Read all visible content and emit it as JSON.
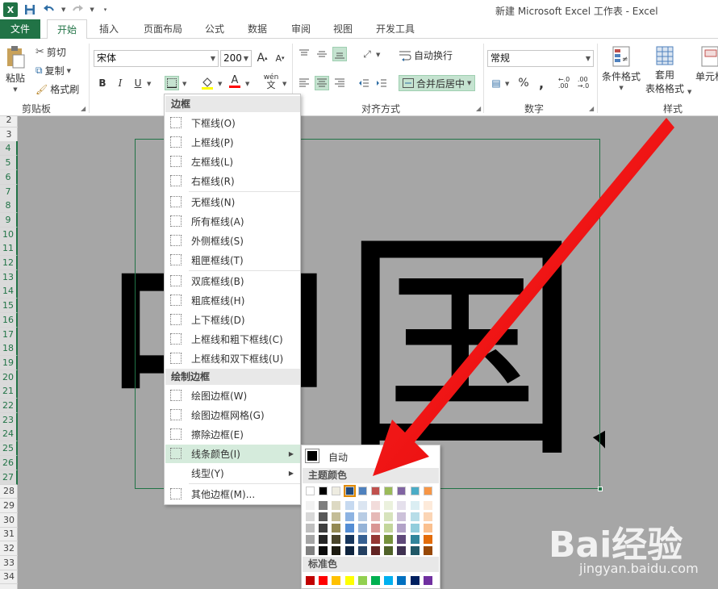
{
  "window": {
    "title": "新建 Microsoft Excel 工作表 - Excel"
  },
  "qat": {
    "logo_letter": "X",
    "save_icon": "save-icon",
    "undo_icon": "undo-icon",
    "redo_icon": "redo-icon"
  },
  "tabs": [
    {
      "label": "文件"
    },
    {
      "label": "开始"
    },
    {
      "label": "插入"
    },
    {
      "label": "页面布局"
    },
    {
      "label": "公式"
    },
    {
      "label": "数据"
    },
    {
      "label": "审阅"
    },
    {
      "label": "视图"
    },
    {
      "label": "开发工具"
    }
  ],
  "ribbon": {
    "clipboard": {
      "paste": "粘贴",
      "cut": "剪切",
      "copy": "复制",
      "format_painter": "格式刷",
      "label": "剪贴板"
    },
    "font": {
      "name": "宋体",
      "size": "200",
      "bold": "B",
      "italic": "I",
      "underline": "U",
      "grow": "A",
      "shrink": "A",
      "font_color_letter": "A",
      "wen": "wén",
      "wen_char": "文"
    },
    "alignment": {
      "wrap": "自动换行",
      "merge": "合并后居中",
      "label": "对齐方式"
    },
    "number": {
      "format": "常规",
      "percent": "%",
      "comma": ",",
      "label": "数字"
    },
    "styles": {
      "conditional": "条件格式",
      "table_format_1": "套用",
      "table_format_2": "表格格式",
      "cell_styles": "单元格",
      "label": "样式"
    }
  },
  "rows": [
    "2",
    "3",
    "4",
    "5",
    "6",
    "7",
    "8",
    "9",
    "10",
    "11",
    "12",
    "13",
    "14",
    "15",
    "16",
    "17",
    "18",
    "19",
    "20",
    "21",
    "22",
    "23",
    "24",
    "25",
    "26",
    "27",
    "28",
    "29",
    "30",
    "31",
    "32",
    "33",
    "34"
  ],
  "cell_text": "中国人",
  "border_menu": {
    "header_borders": "边框",
    "items_a": [
      "下框线(O)",
      "上框线(P)",
      "左框线(L)",
      "右框线(R)"
    ],
    "items_b": [
      "无框线(N)",
      "所有框线(A)",
      "外侧框线(S)",
      "粗匣框线(T)"
    ],
    "items_c": [
      "双底框线(B)",
      "粗底框线(H)",
      "上下框线(D)",
      "上框线和粗下框线(C)",
      "上框线和双下框线(U)"
    ],
    "header_draw": "绘制边框",
    "items_d": [
      "绘图边框(W)",
      "绘图边框网格(G)",
      "擦除边框(E)",
      "线条颜色(I)",
      "线型(Y)"
    ],
    "items_e": [
      "其他边框(M)..."
    ]
  },
  "color_menu": {
    "auto": "自动",
    "theme_header": "主题颜色",
    "standard_header": "标准色",
    "theme_top": [
      "#ffffff",
      "#000000",
      "#eeece1",
      "#1f497d",
      "#4f81bd",
      "#c0504d",
      "#9bbb59",
      "#8064a2",
      "#4bacc6",
      "#f79646"
    ],
    "theme_shades": [
      [
        "#f2f2f2",
        "#7f7f7f",
        "#ddd9c3",
        "#c6d9f0",
        "#dbe5f1",
        "#f2dcdb",
        "#ebf1dd",
        "#e5e0ec",
        "#dbeef3",
        "#fdeada"
      ],
      [
        "#d8d8d8",
        "#595959",
        "#c4bd97",
        "#8db3e2",
        "#b8cce4",
        "#e5b9b7",
        "#d7e3bc",
        "#ccc1d9",
        "#b7dde8",
        "#fbd5b5"
      ],
      [
        "#bfbfbf",
        "#3f3f3f",
        "#938953",
        "#548dd4",
        "#95b3d7",
        "#d99694",
        "#c3d69b",
        "#b2a2c7",
        "#92cddc",
        "#fac08f"
      ],
      [
        "#a5a5a5",
        "#262626",
        "#494429",
        "#17365d",
        "#366092",
        "#953734",
        "#76923c",
        "#5f497a",
        "#31859b",
        "#e36c09"
      ],
      [
        "#7f7f7f",
        "#0c0c0c",
        "#1d1b10",
        "#0f243e",
        "#244061",
        "#632423",
        "#4f6128",
        "#3f3151",
        "#205867",
        "#974806"
      ]
    ],
    "standard": [
      "#c00000",
      "#ff0000",
      "#ffc000",
      "#ffff00",
      "#92d050",
      "#00b050",
      "#00b0f0",
      "#0070c0",
      "#002060",
      "#7030a0"
    ],
    "selected_index": 3
  },
  "watermark": {
    "logo": "Bai经验",
    "url": "jingyan.baidu.com"
  }
}
